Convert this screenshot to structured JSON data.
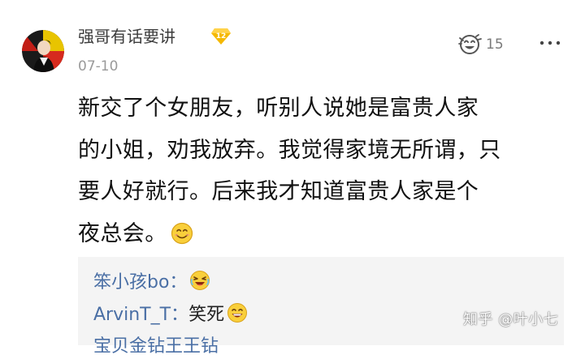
{
  "comment": {
    "author_name": "强哥有话要讲",
    "level_badge": "12",
    "date": "07-10",
    "like_count": "15",
    "body_lines": [
      "新交了个女朋友，听别人说她是富贵人家",
      "的小姐，劝我放弃。我觉得家境无所谓，只",
      "要人好就行。后来我才知道富贵人家是个",
      "夜总会。"
    ]
  },
  "replies": [
    {
      "user": "笨小孩bo：",
      "text": "",
      "emoji": "laughing-crying-emoji"
    },
    {
      "user": "ArvinT_T：",
      "text": "笑死",
      "emoji": "grinning-emoji"
    },
    {
      "user": "宝贝金钻王王钻",
      "text": "",
      "emoji": ""
    }
  ],
  "watermark": "知乎 @叶小七",
  "icons": {
    "avatar": "avatar-image",
    "level": "diamond-level-icon",
    "like": "like-face-icon",
    "more": "more-dots-icon",
    "smile": "smile-emoji"
  },
  "colors": {
    "reply_user": "#4a6fa5",
    "badge": "#f5b800",
    "reply_bg": "#f4f4f4"
  }
}
